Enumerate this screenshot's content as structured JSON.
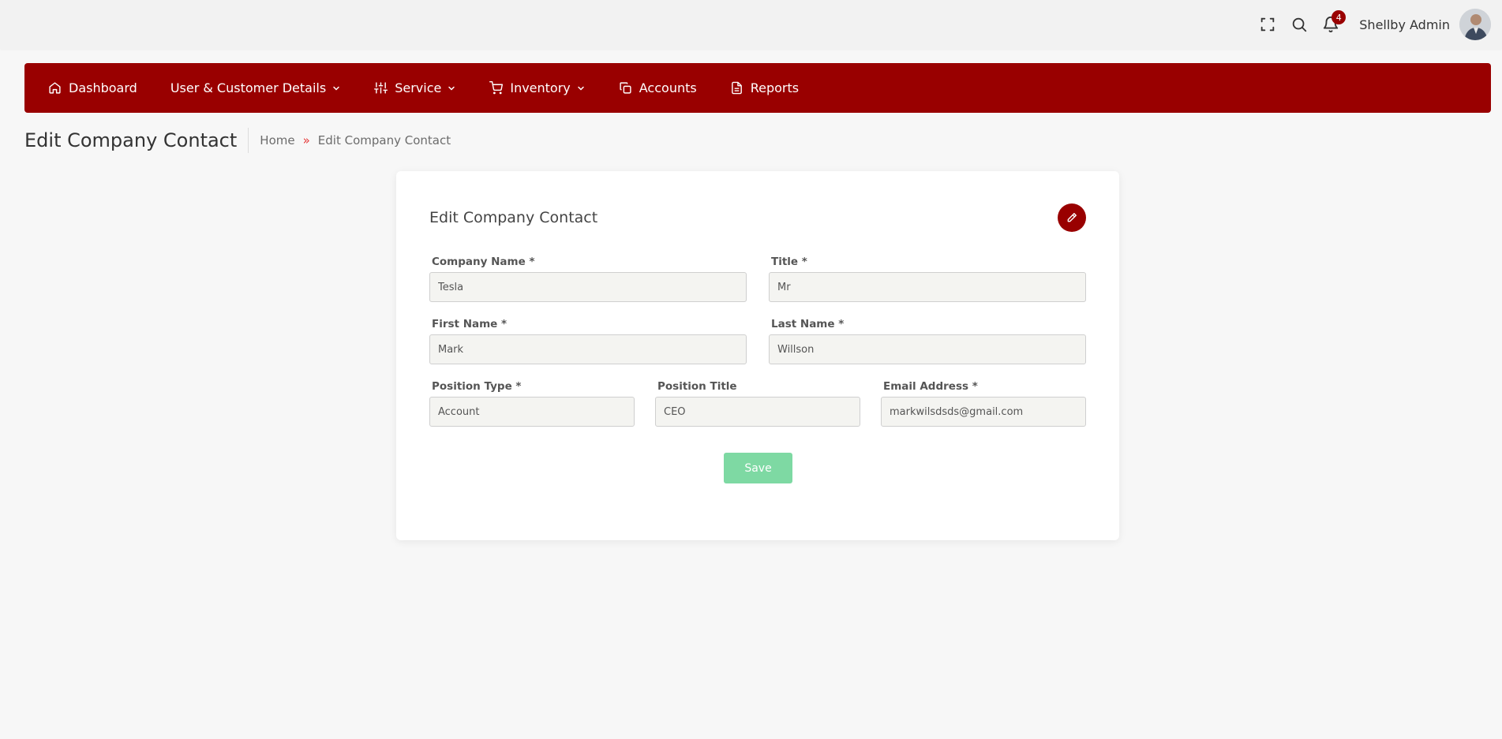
{
  "header": {
    "user_name": "Shellby Admin",
    "notification_count": "4",
    "icons": [
      "fullscreen-icon",
      "search-icon",
      "bell-icon"
    ]
  },
  "nav": {
    "items": [
      {
        "label": "Dashboard",
        "icon": "home-icon",
        "dropdown": false
      },
      {
        "label": "User & Customer Details",
        "icon": "",
        "dropdown": true
      },
      {
        "label": "Service",
        "icon": "sliders-icon",
        "dropdown": true
      },
      {
        "label": "Inventory",
        "icon": "cart-icon",
        "dropdown": true
      },
      {
        "label": "Accounts",
        "icon": "copy-icon",
        "dropdown": false
      },
      {
        "label": "Reports",
        "icon": "file-icon",
        "dropdown": false
      }
    ]
  },
  "page": {
    "title": "Edit Company Contact",
    "breadcrumb": {
      "home": "Home",
      "separator": "»",
      "current": "Edit Company Contact"
    }
  },
  "form": {
    "title": "Edit Company Contact",
    "company_name": {
      "label": "Company Name *",
      "value": "Tesla"
    },
    "title_field": {
      "label": "Title *",
      "value": "Mr"
    },
    "first_name": {
      "label": "First Name *",
      "value": "Mark"
    },
    "last_name": {
      "label": "Last Name *",
      "value": "Willson"
    },
    "position_type": {
      "label": "Position Type *",
      "value": "Account"
    },
    "position_title": {
      "label": "Position Title",
      "value": "CEO"
    },
    "email": {
      "label": "Email Address *",
      "value": "markwilsdsds@gmail.com"
    },
    "save_label": "Save"
  },
  "colors": {
    "brand": "#990000",
    "save_button": "#7ed9a3",
    "breadcrumb_separator": "#e63a3a"
  }
}
